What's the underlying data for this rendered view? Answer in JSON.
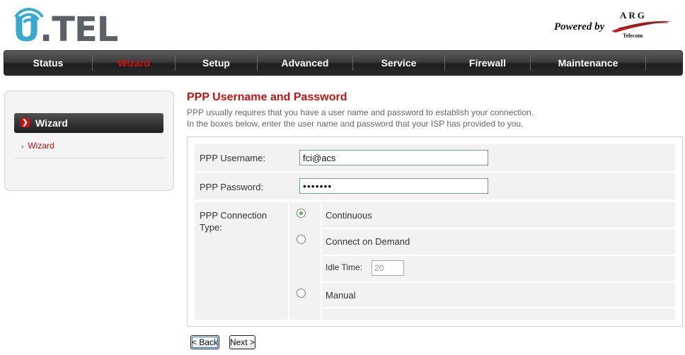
{
  "brand": {
    "logo_text_u": "U",
    "logo_text_rest": ".TEL",
    "powered_by": "Powered by",
    "partner_name": "ARG",
    "partner_sub": "Telecom"
  },
  "nav": {
    "items": [
      "Status",
      "Wizard",
      "Setup",
      "Advanced",
      "Service",
      "Firewall",
      "Maintenance"
    ],
    "active": "Wizard"
  },
  "sidebar": {
    "heading": "Wizard",
    "links": [
      "Wizard"
    ]
  },
  "page": {
    "title": "PPP Username and Password",
    "desc_line1": "PPP usually requires that you have a user name and password to establish your connection.",
    "desc_line2": "In the boxes below, enter the user name and password that your ISP has provided to you."
  },
  "form": {
    "username_label": "PPP Username:",
    "username_value": "fci@acs",
    "password_label": "PPP Password:",
    "password_value": "•••••••",
    "conn_type_label_1": "PPP Connection",
    "conn_type_label_2": "Type:",
    "options": [
      {
        "label": "Continuous",
        "checked": true
      },
      {
        "label": "Connect on Demand",
        "checked": false
      },
      {
        "label": "Manual",
        "checked": false
      }
    ],
    "idle_time_label": "Idle Time:",
    "idle_time_value": "20"
  },
  "buttons": {
    "back": "< Back",
    "next": "Next >"
  },
  "colors": {
    "accent_red": "#c01414",
    "nav_dark": "#2a2a2a"
  }
}
